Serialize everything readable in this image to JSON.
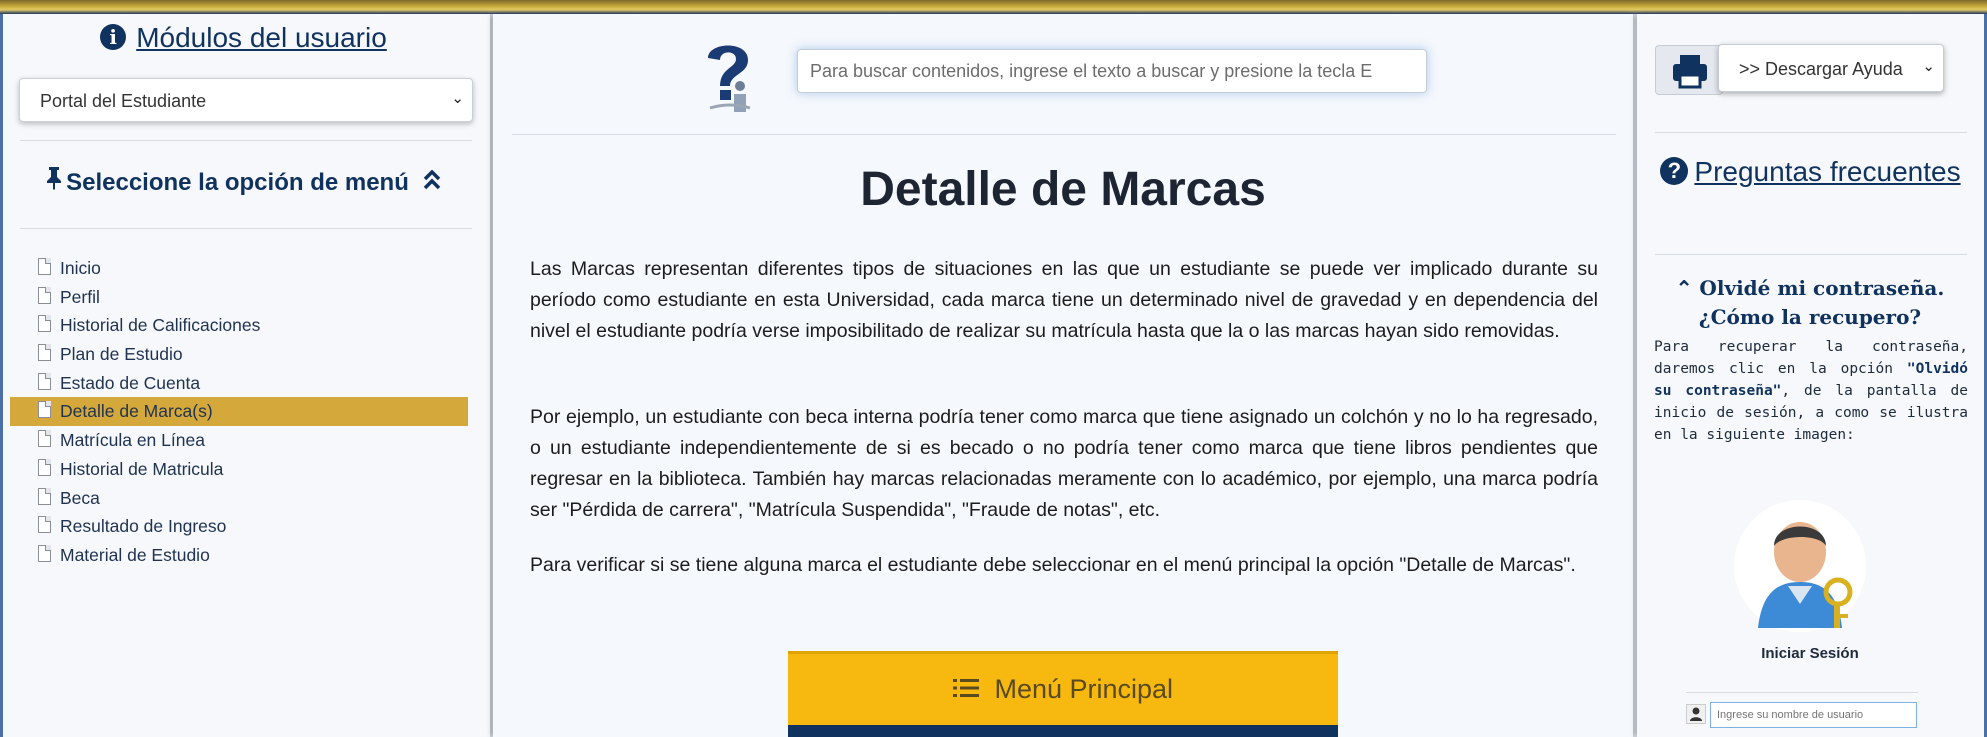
{
  "left": {
    "modules_title": "Módulos del usuario",
    "module_select_value": "Portal del Estudiante",
    "menu_heading": "Seleccione la opción de menú",
    "menu_items": [
      {
        "label": "Inicio",
        "active": false
      },
      {
        "label": "Perfil",
        "active": false
      },
      {
        "label": "Historial de Calificaciones",
        "active": false
      },
      {
        "label": "Plan de Estudio",
        "active": false
      },
      {
        "label": "Estado de Cuenta",
        "active": false
      },
      {
        "label": "Detalle de Marca(s)",
        "active": true
      },
      {
        "label": "Matrícula en Línea",
        "active": false
      },
      {
        "label": "Historial de Matricula",
        "active": false
      },
      {
        "label": "Beca",
        "active": false
      },
      {
        "label": "Resultado de Ingreso",
        "active": false
      },
      {
        "label": "Material de Estudio",
        "active": false
      }
    ]
  },
  "center": {
    "search_placeholder": "Para buscar contenidos, ingrese el texto a buscar y presione la tecla E",
    "title": "Detalle de Marcas",
    "paragraphs": [
      "Las Marcas representan diferentes tipos de situaciones en las que un estudiante se puede ver implicado durante su período como estudiante en esta Universidad, cada marca tiene un determinado nivel de gravedad y en dependencia del nivel el estudiante podría verse imposibilitado de realizar su matrícula hasta que la o las marcas hayan sido removidas.",
      "Por ejemplo, un estudiante con beca interna podría tener como marca que tiene asignado un colchón y no lo ha regresado, o un estudiante independientemente de si es becado o no podría tener como marca que tiene libros pendientes que regresar en la biblioteca. También hay marcas relacionadas meramente con lo académico, por ejemplo, una marca podría ser \"Pérdida de carrera\", \"Matrícula Suspendida\", \"Fraude de notas\", etc.",
      "Para verificar si se tiene alguna marca el estudiante debe seleccionar en el menú principal la opción \"Detalle de Marcas\"."
    ],
    "main_menu_button": "Menú Principal"
  },
  "right": {
    "download_select_value": ">> Descargar Ayuda",
    "faq_title": "Preguntas frecuentes",
    "question_title": "Olvidé mi contraseña. ¿Cómo la recupero?",
    "answer_parts": {
      "before": "Para recuperar la contraseña, daremos clic en la opción ",
      "bold": "\"Olvidó su contraseña\"",
      "after": ", de la pantalla de inicio de sesión, a como se ilustra en la siguiente imagen:"
    },
    "login_label": "Iniciar Sesión",
    "username_placeholder": "Ingrese su nombre de usuario"
  }
}
